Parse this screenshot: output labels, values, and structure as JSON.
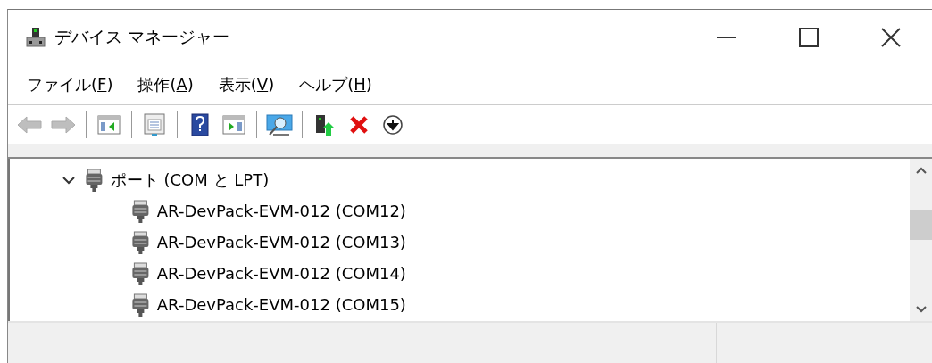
{
  "window": {
    "title": "デバイス マネージャー"
  },
  "menu": [
    {
      "before": "ファイル(",
      "key": "F",
      "after": ")"
    },
    {
      "before": "操作(",
      "key": "A",
      "after": ")"
    },
    {
      "before": "表示(",
      "key": "V",
      "after": ")"
    },
    {
      "before": "ヘルプ(",
      "key": "H",
      "after": ")"
    }
  ],
  "toolbar": [
    {
      "kind": "back",
      "disabled": true
    },
    {
      "kind": "forward",
      "disabled": true
    },
    {
      "kind": "separator"
    },
    {
      "kind": "tree-pane",
      "disabled": false
    },
    {
      "kind": "separator"
    },
    {
      "kind": "properties",
      "disabled": false
    },
    {
      "kind": "separator"
    },
    {
      "kind": "help",
      "disabled": false
    },
    {
      "kind": "action-pane",
      "disabled": false
    },
    {
      "kind": "separator"
    },
    {
      "kind": "scan",
      "disabled": false
    },
    {
      "kind": "separator"
    },
    {
      "kind": "update",
      "disabled": false
    },
    {
      "kind": "uninstall",
      "disabled": false
    },
    {
      "kind": "download",
      "disabled": false
    }
  ],
  "tree": [
    {
      "label": "ポート (COM と LPT)",
      "expanded": true,
      "children": [
        {
          "label": "AR-DevPack-EVM-012 (COM12)"
        },
        {
          "label": "AR-DevPack-EVM-012 (COM13)"
        },
        {
          "label": "AR-DevPack-EVM-012 (COM14)"
        },
        {
          "label": "AR-DevPack-EVM-012 (COM15)"
        }
      ]
    }
  ]
}
